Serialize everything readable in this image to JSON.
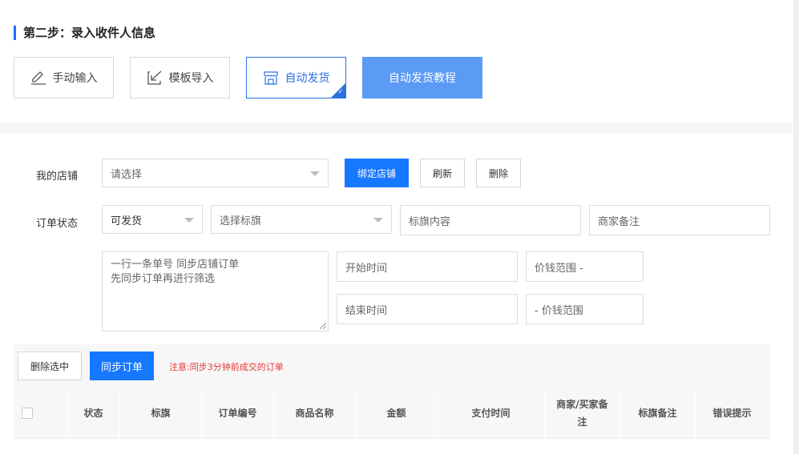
{
  "step": {
    "title": "第二步：录入收件人信息"
  },
  "modes": {
    "manual": "手动输入",
    "template": "模板导入",
    "auto": "自动发货",
    "tutorial": "自动发货教程"
  },
  "shop": {
    "label": "我的店铺",
    "placeholder": "请选择",
    "bind_button": "绑定店铺",
    "refresh_button": "刷新",
    "delete_button": "删除"
  },
  "order": {
    "label": "订单状态",
    "status_value": "可发货",
    "flag_placeholder": "选择标旗",
    "flag_content_placeholder": "标旗内容",
    "merchant_note_placeholder": "商家备注",
    "order_numbers_placeholder_line1": "一行一条单号 同步店铺订单",
    "order_numbers_placeholder_line2": "先同步订单再进行筛选",
    "start_time_placeholder": "开始时间",
    "end_time_placeholder": "结束时间",
    "price_min_placeholder": "价钱范围 -",
    "price_max_placeholder": "- 价钱范围"
  },
  "actions": {
    "delete_selected": "删除选中",
    "sync_orders": "同步订单",
    "note": "注意:同步3分钟前成交的订单"
  },
  "table": {
    "columns": [
      "状态",
      "标旗",
      "订单编号",
      "商品名称",
      "金额",
      "支付时间",
      "商家/买家备注",
      "标旗备注",
      "错误提示"
    ]
  },
  "colors": {
    "accent": "#1677ff",
    "tutorial": "#5b9af5",
    "warning": "#e53935"
  }
}
